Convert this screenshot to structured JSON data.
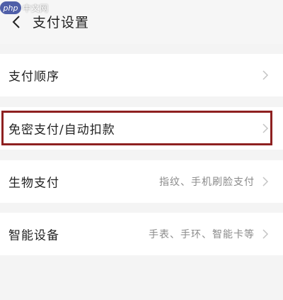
{
  "watermark": {
    "logo": "php",
    "text": "中文网"
  },
  "header": {
    "title": "支付设置",
    "back_icon": "chevron-left-icon"
  },
  "rows": [
    {
      "label": "支付顺序",
      "value": ""
    },
    {
      "label": "免密支付/自动扣款",
      "value": "",
      "highlighted": true
    },
    {
      "label": "生物支付",
      "value": "指纹、手机刷脸支付"
    },
    {
      "label": "智能设备",
      "value": "手表、手环、智能卡等"
    }
  ],
  "colors": {
    "background": "#f4f4f4",
    "row_background": "#ffffff",
    "highlight_border": "#8e2020",
    "chevron": "#c4c4c4"
  }
}
